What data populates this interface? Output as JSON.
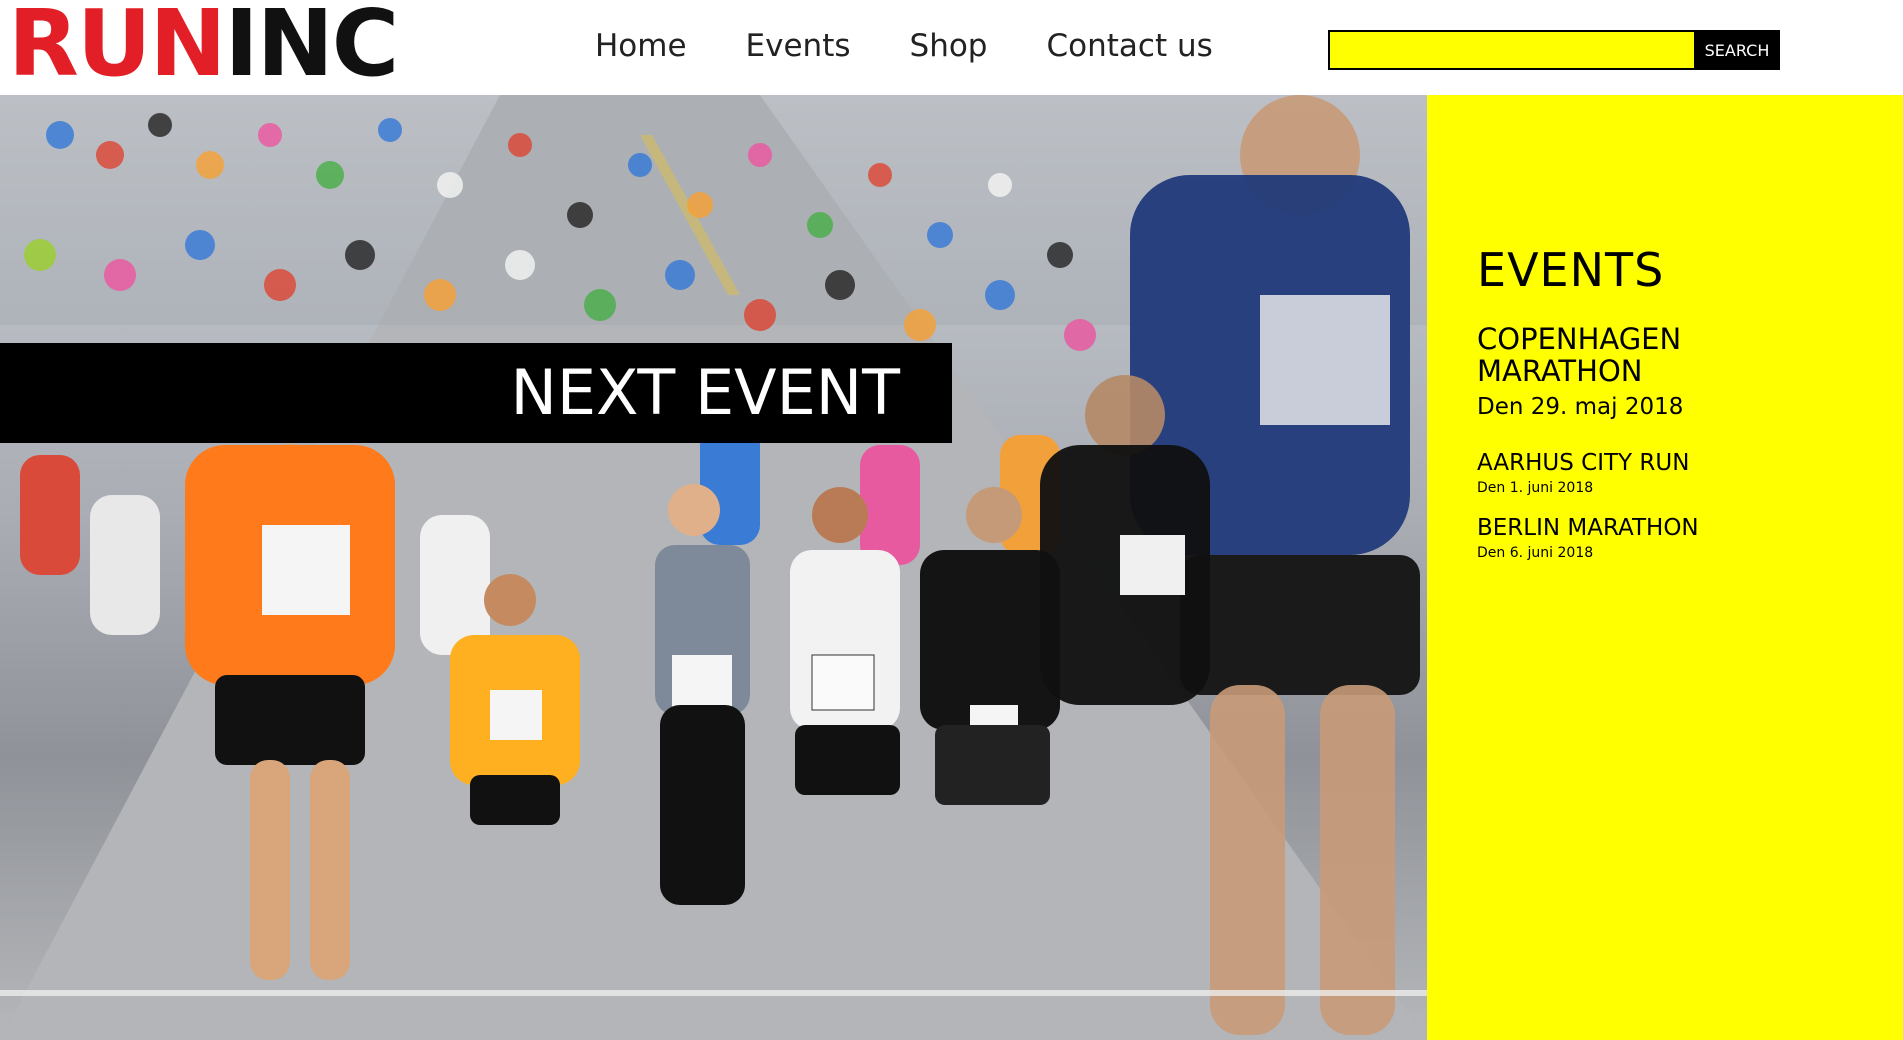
{
  "logo": {
    "part1": "RUN",
    "part2": "INC"
  },
  "nav": {
    "items": [
      "Home",
      "Events",
      "Shop",
      "Contact us"
    ]
  },
  "search": {
    "placeholder": "",
    "button_label": "SEARCH"
  },
  "hero": {
    "banner_text": "NEXT EVENT"
  },
  "events": {
    "heading": "EVENTS",
    "items": [
      {
        "name": "COPENHAGEN MARATHON",
        "date": "Den 29. maj 2018"
      },
      {
        "name": "AARHUS CITY RUN",
        "date": "Den 1. juni 2018"
      },
      {
        "name": "BERLIN MARATHON",
        "date": "Den 6. juni 2018"
      }
    ]
  },
  "colors": {
    "brand_red": "#e21f26",
    "accent_yellow": "#ffff00",
    "band_black": "#000000"
  }
}
